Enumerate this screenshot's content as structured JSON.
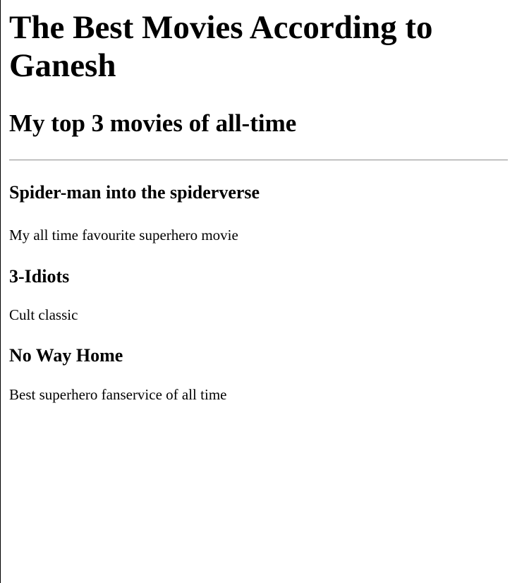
{
  "page": {
    "title": "The Best Movies According to Ganesh",
    "subtitle": "My top 3 movies of all-time"
  },
  "movies": [
    {
      "title": "Spider-man into the spiderverse",
      "description": "My all time favourite superhero movie"
    },
    {
      "title": "3-Idiots",
      "description": "Cult classic"
    },
    {
      "title": "No Way Home",
      "description": "Best superhero fanservice of all time"
    }
  ]
}
